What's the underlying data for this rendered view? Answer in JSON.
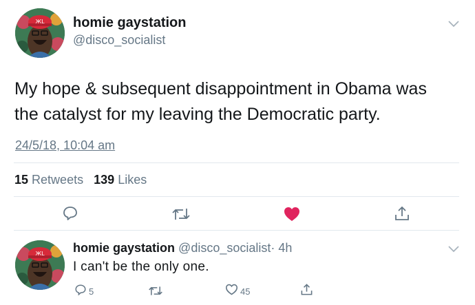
{
  "main_tweet": {
    "author_name": "homie gaystation",
    "author_handle": "@disco_socialist",
    "text_line1": "My hope & subsequent disappointment in Obama was",
    "text_line2": "the catalyst for my leaving the Democratic party.",
    "timestamp": "24/5/18, 10:04 am",
    "retweets_count": "15",
    "retweets_label": "Retweets",
    "likes_count": "139",
    "likes_label": "Likes",
    "liked": true,
    "like_color": "#e0245e"
  },
  "reply": {
    "author_name": "homie gaystation",
    "author_handle": "@disco_socialist",
    "time": "· 4h",
    "text": "I can't be the only one.",
    "reply_count": "5",
    "like_count": "45"
  },
  "icons": [
    "chevron-down-icon",
    "reply-icon",
    "retweet-icon",
    "heart-icon",
    "share-icon"
  ]
}
